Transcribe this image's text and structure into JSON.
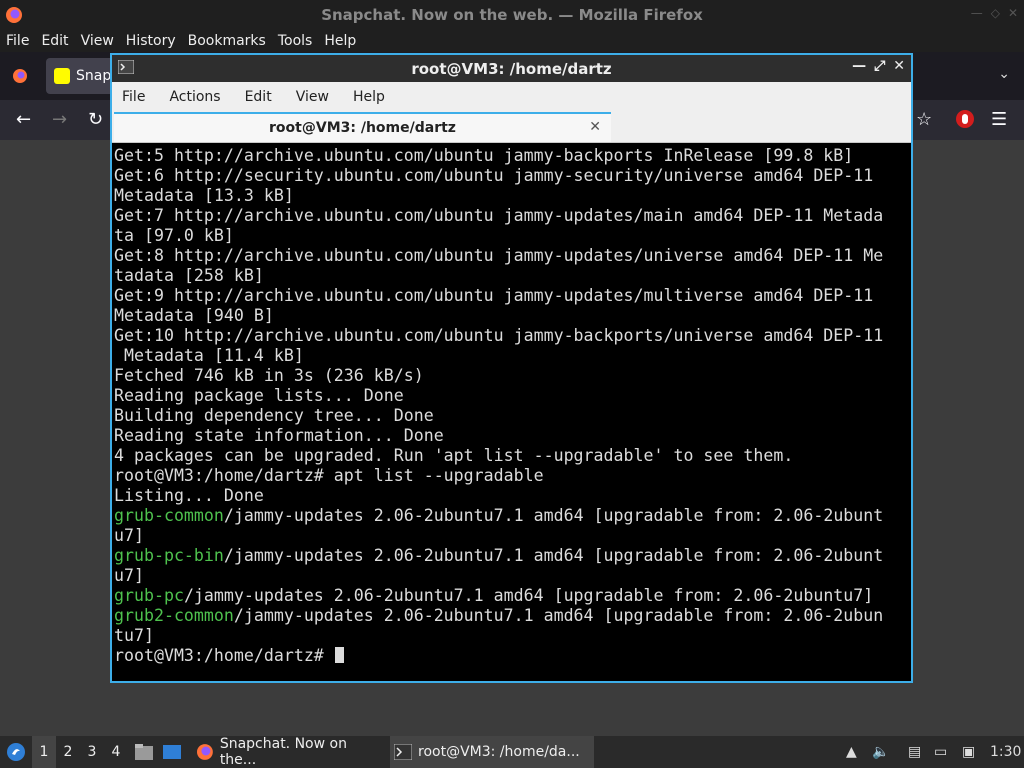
{
  "firefox": {
    "window_title": "Snapchat. Now on the web. — Mozilla Firefox",
    "menu": [
      "File",
      "Edit",
      "View",
      "History",
      "Bookmarks",
      "Tools",
      "Help"
    ],
    "tab_label": "Snap",
    "brand_color": "#ff7139"
  },
  "terminal": {
    "window_title": "root@VM3: /home/dartz",
    "menu": [
      "File",
      "Actions",
      "Edit",
      "View",
      "Help"
    ],
    "tab_label": "root@VM3: /home/dartz",
    "accent": "#3daee9",
    "lines": [
      {
        "text": "Get:5 http://archive.ubuntu.com/ubuntu jammy-backports InRelease [99.8 kB]"
      },
      {
        "text": "Get:6 http://security.ubuntu.com/ubuntu jammy-security/universe amd64 DEP-11"
      },
      {
        "text": "Metadata [13.3 kB]"
      },
      {
        "text": "Get:7 http://archive.ubuntu.com/ubuntu jammy-updates/main amd64 DEP-11 Metada"
      },
      {
        "text": "ta [97.0 kB]"
      },
      {
        "text": "Get:8 http://archive.ubuntu.com/ubuntu jammy-updates/universe amd64 DEP-11 Me"
      },
      {
        "text": "tadata [258 kB]"
      },
      {
        "text": "Get:9 http://archive.ubuntu.com/ubuntu jammy-updates/multiverse amd64 DEP-11"
      },
      {
        "text": "Metadata [940 B]"
      },
      {
        "text": "Get:10 http://archive.ubuntu.com/ubuntu jammy-backports/universe amd64 DEP-11"
      },
      {
        "text": " Metadata [11.4 kB]"
      },
      {
        "text": "Fetched 746 kB in 3s (236 kB/s)"
      },
      {
        "text": "Reading package lists... Done"
      },
      {
        "text": "Building dependency tree... Done"
      },
      {
        "text": "Reading state information... Done"
      },
      {
        "text": "4 packages can be upgraded. Run 'apt list --upgradable' to see them."
      },
      {
        "text": "root@VM3:/home/dartz# apt list --upgradable"
      },
      {
        "text": "Listing... Done"
      },
      {
        "pkg": "grub-common",
        "text": "/jammy-updates 2.06-2ubuntu7.1 amd64 [upgradable from: 2.06-2ubunt"
      },
      {
        "text": "u7]"
      },
      {
        "pkg": "grub-pc-bin",
        "text": "/jammy-updates 2.06-2ubuntu7.1 amd64 [upgradable from: 2.06-2ubunt"
      },
      {
        "text": "u7]"
      },
      {
        "pkg": "grub-pc",
        "text": "/jammy-updates 2.06-2ubuntu7.1 amd64 [upgradable from: 2.06-2ubuntu7]"
      },
      {
        "pkg": "grub2-common",
        "text": "/jammy-updates 2.06-2ubuntu7.1 amd64 [upgradable from: 2.06-2ubun"
      },
      {
        "text": "tu7]"
      }
    ],
    "prompt": "root@VM3:/home/dartz# ",
    "package_color": "#4ec24e"
  },
  "taskbar": {
    "workspaces": [
      "1",
      "2",
      "3",
      "4"
    ],
    "tasks": [
      {
        "label": "Snapchat. Now on the...",
        "icon": "firefox-icon"
      },
      {
        "label": "root@VM3: /home/da...",
        "icon": "terminal-icon"
      }
    ],
    "clock": "1:30"
  }
}
